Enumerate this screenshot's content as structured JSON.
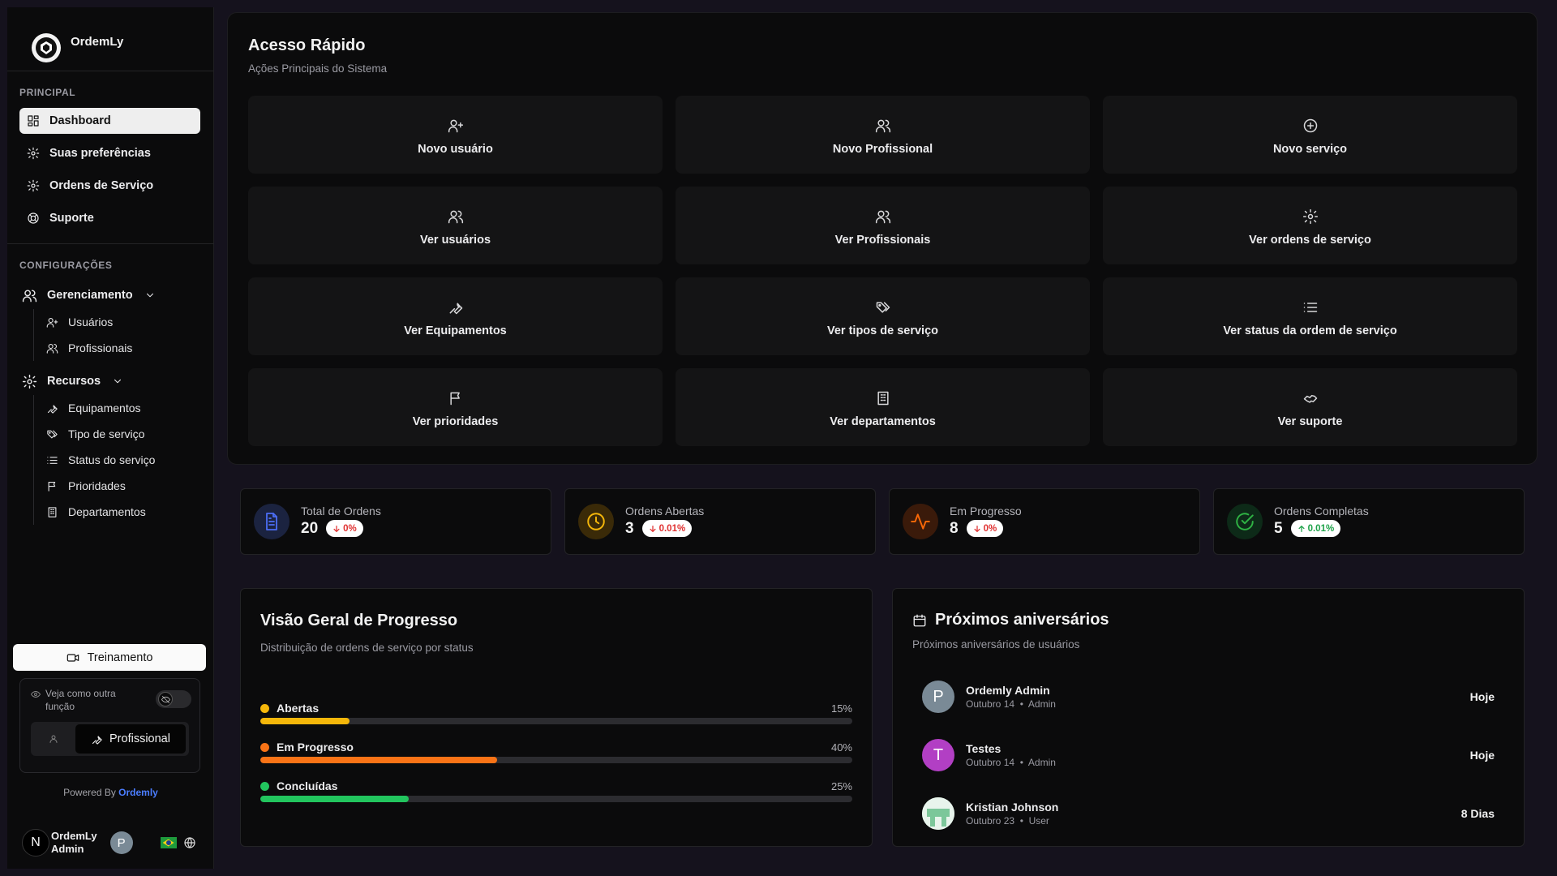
{
  "app": {
    "name": "OrdemLy"
  },
  "sidebar": {
    "principal_label": "PRINCIPAL",
    "principal_items": [
      {
        "label": "Dashboard",
        "icon": "dashboard-icon"
      },
      {
        "label": "Suas preferências",
        "icon": "gear-icon"
      },
      {
        "label": "Ordens de Serviço",
        "icon": "gear-icon"
      },
      {
        "label": "Suporte",
        "icon": "lifebuoy-icon"
      }
    ],
    "config_label": "CONFIGURAÇÕES",
    "gerenciamento": {
      "label": "Gerenciamento",
      "items": [
        {
          "label": "Usuários",
          "icon": "user-plus-icon"
        },
        {
          "label": "Profissionais",
          "icon": "users-icon"
        }
      ]
    },
    "recursos": {
      "label": "Recursos",
      "items": [
        {
          "label": "Equipamentos",
          "icon": "wrench-icon"
        },
        {
          "label": "Tipo de serviço",
          "icon": "tags-icon"
        },
        {
          "label": "Status do serviço",
          "icon": "list-icon"
        },
        {
          "label": "Prioridades",
          "icon": "flag-icon"
        },
        {
          "label": "Departamentos",
          "icon": "building-icon"
        }
      ]
    },
    "training_label": "Treinamento",
    "role_view_text": "Veja como outra função",
    "role_active": "Profissional",
    "powered_prefix": "Powered By",
    "powered_brand": "Ordemly",
    "user": {
      "initial": "N",
      "name_line1": "OrdemLy",
      "name_line2": "Admin",
      "avatar_letter": "P"
    }
  },
  "quick_access": {
    "title": "Acesso Rápido",
    "subtitle": "Ações Principais do Sistema",
    "actions": [
      {
        "label": "Novo usuário",
        "icon": "user-plus-icon"
      },
      {
        "label": "Novo Profissional",
        "icon": "users-icon"
      },
      {
        "label": "Novo serviço",
        "icon": "plus-circle-icon"
      },
      {
        "label": "Ver usuários",
        "icon": "users-icon"
      },
      {
        "label": "Ver Profissionais",
        "icon": "users-icon"
      },
      {
        "label": "Ver ordens de serviço",
        "icon": "gear-icon"
      },
      {
        "label": "Ver Equipamentos",
        "icon": "wrench-icon"
      },
      {
        "label": "Ver tipos de serviço",
        "icon": "tags-icon"
      },
      {
        "label": "Ver status da ordem de serviço",
        "icon": "list-icon"
      },
      {
        "label": "Ver prioridades",
        "icon": "flag-icon"
      },
      {
        "label": "Ver departamentos",
        "icon": "building-icon"
      },
      {
        "label": "Ver suporte",
        "icon": "handshake-icon"
      }
    ]
  },
  "stats": [
    {
      "label": "Total de Ordens",
      "value": "20",
      "badge": "0%",
      "trend": "down",
      "color": "#3b5bdb"
    },
    {
      "label": "Ordens Abertas",
      "value": "3",
      "badge": "0.01%",
      "trend": "down",
      "color": "#f59f00"
    },
    {
      "label": "Em Progresso",
      "value": "8",
      "badge": "0%",
      "trend": "down",
      "color": "#f76707"
    },
    {
      "label": "Ordens Completas",
      "value": "5",
      "badge": "0.01%",
      "trend": "up",
      "color": "#2fb344"
    }
  ],
  "progress": {
    "title": "Visão Geral de Progresso",
    "subtitle": "Distribuição de ordens de serviço por status",
    "bars": [
      {
        "label": "Abertas",
        "percent_label": "15%",
        "value": 0.15,
        "color": "#f5b70a"
      },
      {
        "label": "Em Progresso",
        "percent_label": "40%",
        "value": 0.4,
        "color": "#f97316"
      },
      {
        "label": "Concluídas",
        "percent_label": "25%",
        "value": 0.25,
        "color": "#22c55e"
      }
    ]
  },
  "birthdays": {
    "title": "Próximos aniversários",
    "subtitle": "Próximos aniversários de usuários",
    "people": [
      {
        "letter": "P",
        "name": "Ordemly Admin",
        "date": "Outubro 14",
        "role": "Admin",
        "when": "Hoje",
        "color": "#7a8a96"
      },
      {
        "letter": "T",
        "name": "Testes",
        "date": "Outubro 14",
        "role": "Admin",
        "when": "Hoje",
        "color": "#b23fc4"
      },
      {
        "letter": "",
        "name": "Kristian Johnson",
        "date": "Outubro 23",
        "role": "User",
        "when": "8 Dias",
        "color": "#d8efe0"
      }
    ]
  }
}
